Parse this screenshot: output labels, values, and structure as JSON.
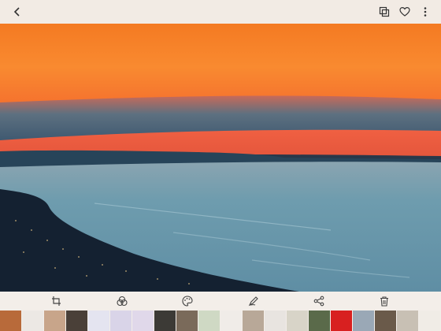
{
  "topbar": {
    "back_icon": "chevron-left-icon",
    "actions": [
      "copy-icon",
      "heart-icon",
      "more-vertical-icon"
    ]
  },
  "photo": {
    "subject": "coastal-sunset",
    "colors": {
      "sky_top": "#f7832a",
      "sky_band": "#f0603a",
      "cloud": "#4e6a80",
      "sea": "#6796a8",
      "land": "#152030"
    }
  },
  "toolbar": {
    "actions": [
      "crop-rotate-icon",
      "filters-icon",
      "palette-icon",
      "draw-icon",
      "share-icon",
      "trash-icon"
    ]
  },
  "filmstrip": {
    "thumbnails": [
      {
        "color": "#b86a3a"
      },
      {
        "color": "#ece8e4"
      },
      {
        "color": "#c8a58a"
      },
      {
        "color": "#4a4038"
      },
      {
        "color": "#e4e4f0"
      },
      {
        "color": "#d9d4e8"
      },
      {
        "color": "#e0d8ea"
      },
      {
        "color": "#3c3a36"
      },
      {
        "color": "#7a6a5a"
      },
      {
        "color": "#cfd9c4"
      },
      {
        "color": "#f0ece8"
      },
      {
        "color": "#b8a898"
      },
      {
        "color": "#e8e4e0"
      },
      {
        "color": "#d8d4c8"
      },
      {
        "color": "#5a6a4a"
      },
      {
        "color": "#d82020"
      },
      {
        "color": "#9aa8b6"
      },
      {
        "color": "#6a5a4a"
      },
      {
        "color": "#c8c0b4"
      },
      {
        "color": "#f0ece6"
      }
    ]
  }
}
